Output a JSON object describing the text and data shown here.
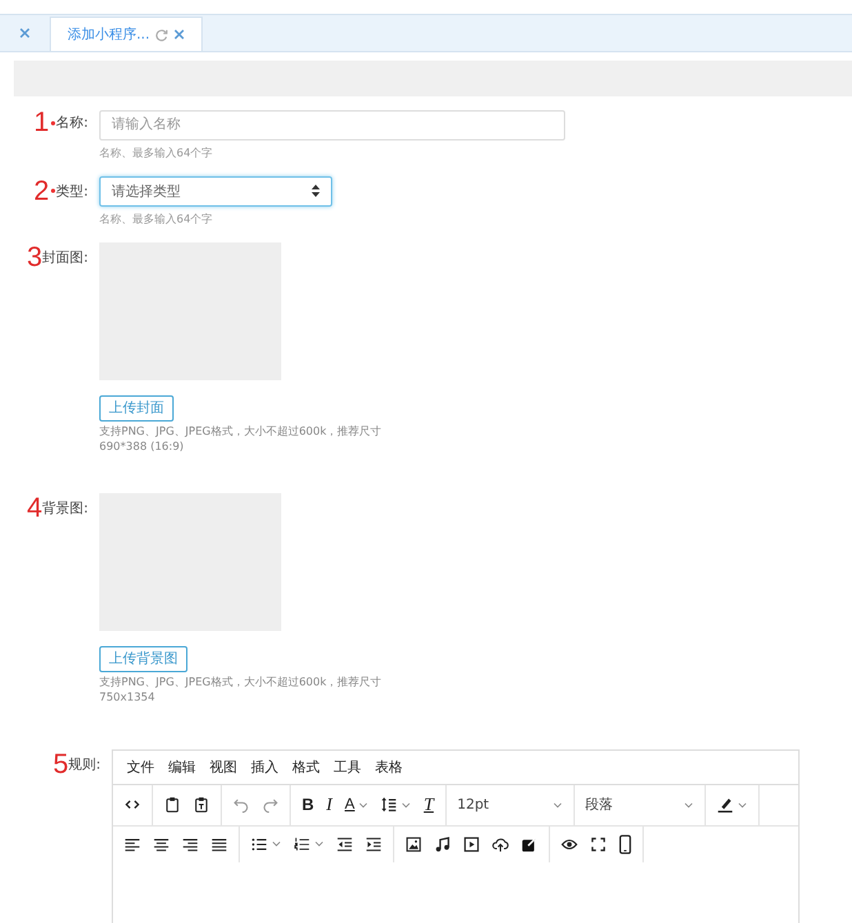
{
  "tabs": [
    {
      "label": "添加小程序...",
      "selected": true
    }
  ],
  "form": {
    "fields": [
      {
        "marker": "1",
        "label": "名称:",
        "required": true,
        "kind": "input",
        "placeholder": "请输入名称",
        "hint": "名称、最多输入64个字",
        "focused": false
      },
      {
        "marker": "2",
        "label": "类型:",
        "required": true,
        "kind": "select",
        "placeholder": "请选择类型",
        "hint": "名称、最多输入64个字",
        "focused": true
      },
      {
        "marker": "3",
        "label": "封面图:",
        "required": false,
        "kind": "image",
        "button": "上传封面",
        "help": [
          "支持PNG、JPG、JPEG格式，大小不超过600k，推荐尺寸",
          "690*388 (16:9)"
        ]
      },
      {
        "marker": "4",
        "label": "背景图:",
        "required": false,
        "kind": "image",
        "button": "上传背景图",
        "help": [
          "支持PNG、JPG、JPEG格式，大小不超过600k，推荐尺寸",
          "750x1354"
        ]
      },
      {
        "marker": "5",
        "label": "规则:",
        "required": false,
        "kind": "editor"
      }
    ]
  },
  "editor": {
    "menu": [
      "文件",
      "编辑",
      "视图",
      "插入",
      "格式",
      "工具",
      "表格"
    ],
    "bold": "B",
    "italic": "I",
    "font_color": "A",
    "clear_format": "T",
    "font_size": "12pt",
    "block_format": "段落"
  }
}
